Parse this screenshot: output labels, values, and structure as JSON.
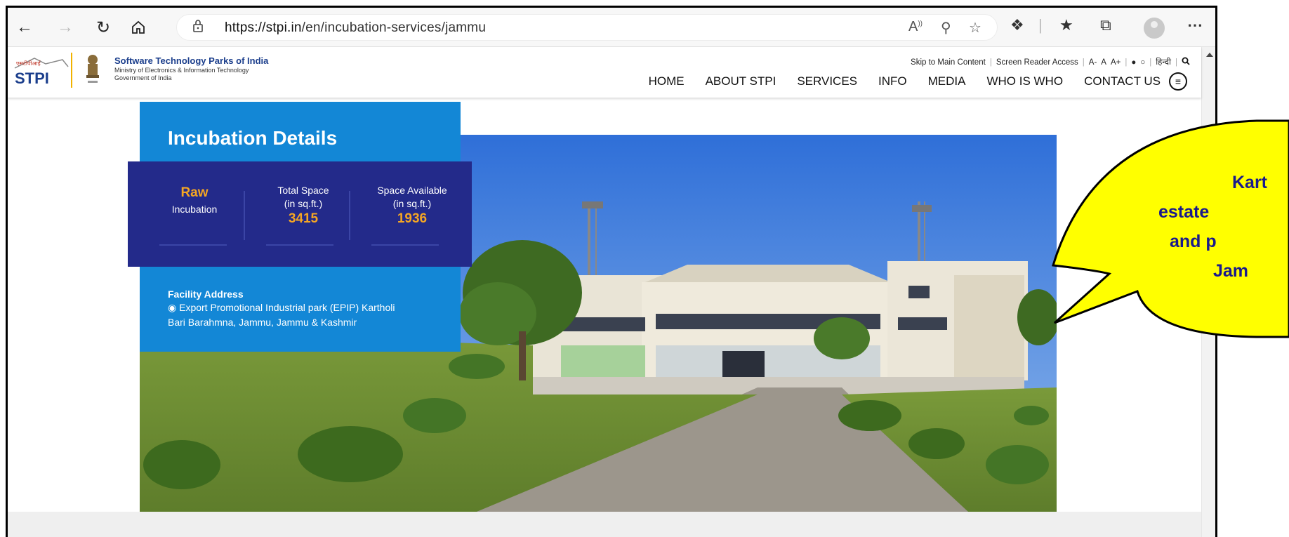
{
  "browser": {
    "url_host": "https://stpi.in",
    "url_path": "/en/incubation-services/jammu"
  },
  "site": {
    "logo_text": "STPI",
    "org_name": "Software Technology Parks of India",
    "org_sub1": "Ministry of Electronics & Information Technology",
    "org_sub2": "Government of India",
    "utility": {
      "skip": "Skip to Main Content",
      "screen_reader": "Screen Reader Access",
      "font_small": "A-",
      "font_normal": "A",
      "font_large": "A+",
      "hindi": "हिन्दी"
    },
    "nav": [
      "HOME",
      "ABOUT STPI",
      "SERVICES",
      "INFO",
      "MEDIA",
      "WHO IS WHO",
      "CONTACT US"
    ]
  },
  "card": {
    "title": "Incubation Details",
    "raw_label": "Raw",
    "raw_sub": "Incubation",
    "total_label": "Total Space",
    "total_unit": "(in sq.ft.)",
    "total_value": "3415",
    "avail_label": "Space Available",
    "avail_unit": "(in sq.ft.)",
    "avail_value": "1936",
    "address_title": "Facility Address",
    "address_line1": "Export Promotional Industrial park (EPIP) Kartholi",
    "address_line2": "Bari Barahmna, Jammu, Jammu & Kashmir"
  },
  "callout": {
    "line1": "Kart",
    "line2": "estate",
    "line3": "and p",
    "line4": "Jam"
  },
  "colors": {
    "card_blue": "#1387d6",
    "stats_navy": "#232a8a",
    "accent_orange": "#f5a623",
    "callout_yellow": "#ffff00",
    "callout_text": "#1a1a8c"
  }
}
